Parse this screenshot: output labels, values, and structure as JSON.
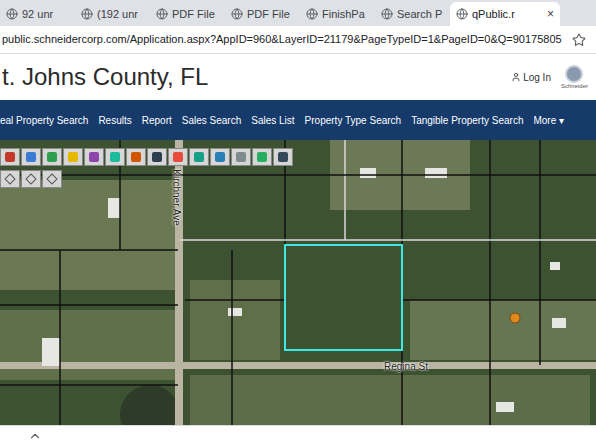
{
  "browser": {
    "tabs": [
      {
        "label": "92 unr",
        "selected": false
      },
      {
        "label": "(192 unr",
        "selected": false
      },
      {
        "label": "PDF File",
        "selected": false
      },
      {
        "label": "PDF File",
        "selected": false
      },
      {
        "label": "FinishPa",
        "selected": false
      },
      {
        "label": "Search P",
        "selected": false
      },
      {
        "label": "qPublic.r",
        "selected": true
      }
    ],
    "close": "×",
    "address": "public.schneidercorp.com/Application.aspx?AppID=960&LayerID=21179&PageTypeID=1&PageID=0&Q=90175805"
  },
  "header": {
    "title": "t. Johns County, FL",
    "login": "Log In",
    "logo": "Schneider"
  },
  "nav": [
    {
      "label": "eal Property Search"
    },
    {
      "label": "Results"
    },
    {
      "label": "Report"
    },
    {
      "label": "Sales Search"
    },
    {
      "label": "Sales List"
    },
    {
      "label": "Property Type Search"
    },
    {
      "label": "Tangible Property Search"
    },
    {
      "label": "More ▾"
    }
  ],
  "map": {
    "streets": [
      {
        "name": "Kirchner Ave",
        "kind": "vertical"
      },
      {
        "name": "Regina St",
        "kind": "horizontal"
      }
    ],
    "selected_parcel": true
  }
}
